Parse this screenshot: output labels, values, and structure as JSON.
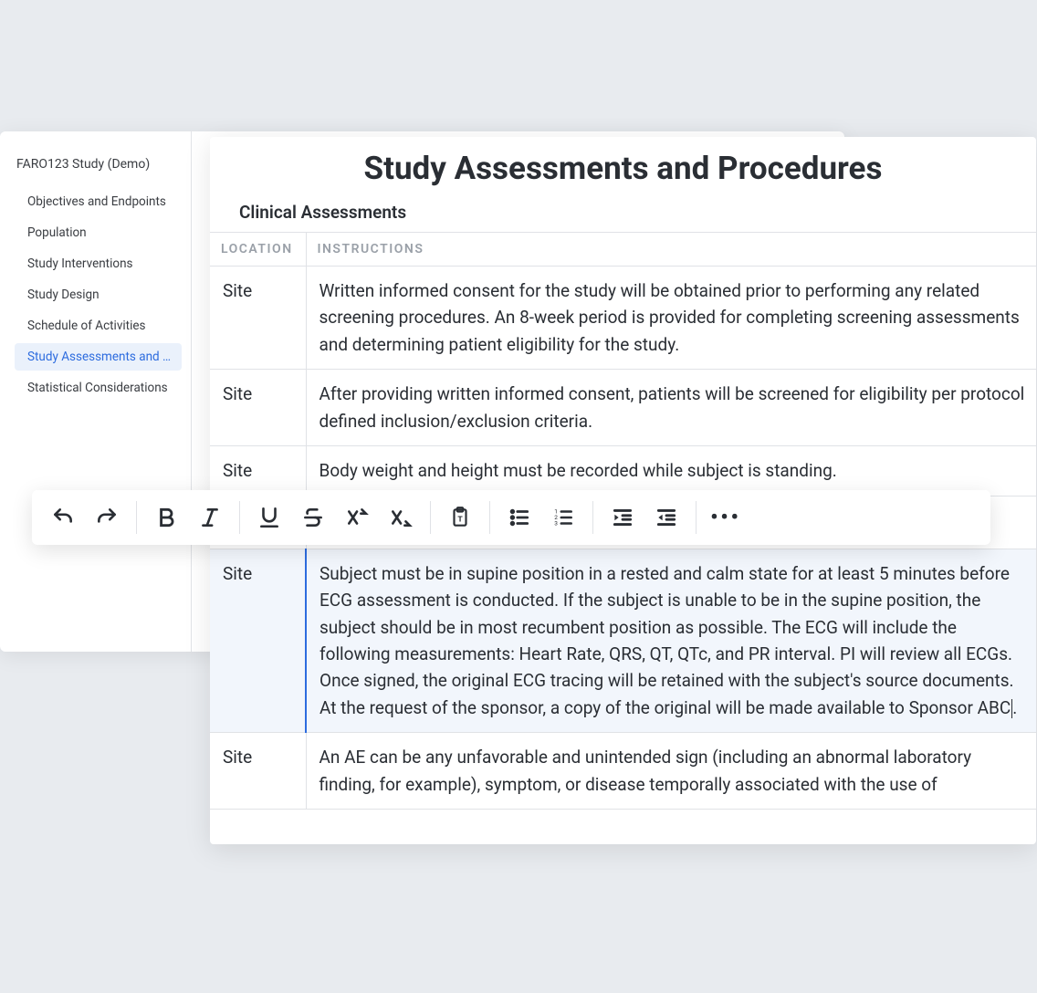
{
  "sidebar": {
    "study_title": "FARO123 Study (Demo)",
    "items": [
      {
        "label": "Objectives and Endpoints",
        "active": false
      },
      {
        "label": "Population",
        "active": false
      },
      {
        "label": "Study Interventions",
        "active": false
      },
      {
        "label": "Study Design",
        "active": false
      },
      {
        "label": "Schedule of Activities",
        "active": false
      },
      {
        "label": "Study Assessments and Pr...",
        "active": true
      },
      {
        "label": "Statistical Considerations",
        "active": false
      }
    ]
  },
  "document": {
    "title": "Study Assessments and Procedures",
    "subtitle": "Clinical Assessments",
    "columns": {
      "location": "LOCATION",
      "instructions": "INSTRUCTIONS"
    },
    "rows": [
      {
        "location": "Site",
        "instructions": "Written informed consent for the study will be obtained prior to performing any related screening procedures. An 8-week period is provided for completing screening assessments and determining patient eligibility for the study."
      },
      {
        "location": "Site",
        "instructions": "After providing written informed consent, patients will be screened for eligibility per protocol defined inclusion/exclusion criteria."
      },
      {
        "location": "Site",
        "instructions": "Body weight and height must be recorded while subject is standing."
      },
      {
        "location": "Site",
        "instructions": "Subject must be in supine position in a rested and calm state for at least 5 minutes before ECG assessment is conducted. If the subject is unable to be in the supine position, the subject should be in most recumbent position as possible. The ECG will include the following measurements: Heart Rate, QRS, QT, QTc, and PR interval. PI will review all ECGs. Once signed, the original ECG tracing will be retained with the subject's source documents. At the request of the sponsor, a copy of the original will be made available to Sponsor ABC",
        "editing": true
      },
      {
        "location": "Site",
        "instructions": "An AE can be any unfavorable and unintended sign (including an abnormal laboratory finding, for example), symptom, or disease temporally associated with the use of"
      }
    ]
  },
  "toolbar": {
    "groups": [
      [
        "undo",
        "redo"
      ],
      [
        "bold",
        "italic"
      ],
      [
        "underline",
        "strikethrough",
        "superscript",
        "subscript"
      ],
      [
        "paste-text"
      ],
      [
        "bulleted-list",
        "numbered-list"
      ],
      [
        "indent-increase",
        "indent-decrease"
      ],
      [
        "more"
      ]
    ]
  }
}
